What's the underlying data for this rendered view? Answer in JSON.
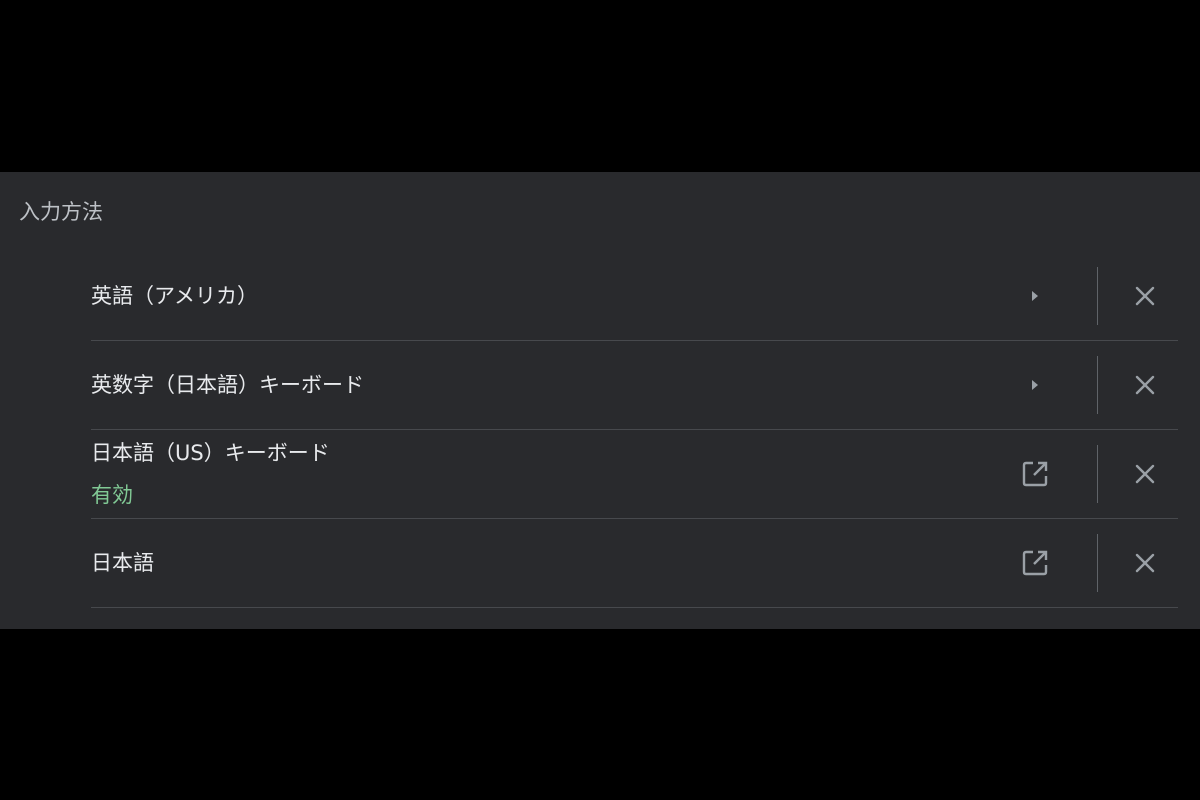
{
  "section": {
    "title": "入力方法"
  },
  "input_methods": [
    {
      "label": "英語（アメリカ）",
      "status": "",
      "action_icon": "arrow-right-icon",
      "remove_icon": "close-icon"
    },
    {
      "label": "英数字（日本語）キーボード",
      "status": "",
      "action_icon": "arrow-right-icon",
      "remove_icon": "close-icon"
    },
    {
      "label": "日本語（US）キーボード",
      "status": "有効",
      "action_icon": "open-in-new-icon",
      "remove_icon": "close-icon"
    },
    {
      "label": "日本語",
      "status": "",
      "action_icon": "open-in-new-icon",
      "remove_icon": "close-icon"
    }
  ],
  "colors": {
    "panel_bg": "#292a2d",
    "text_primary": "#e8eaed",
    "text_secondary": "#bdc1c6",
    "status_active": "#81c995",
    "icon": "#9aa0a6",
    "separator": "#47494d"
  }
}
